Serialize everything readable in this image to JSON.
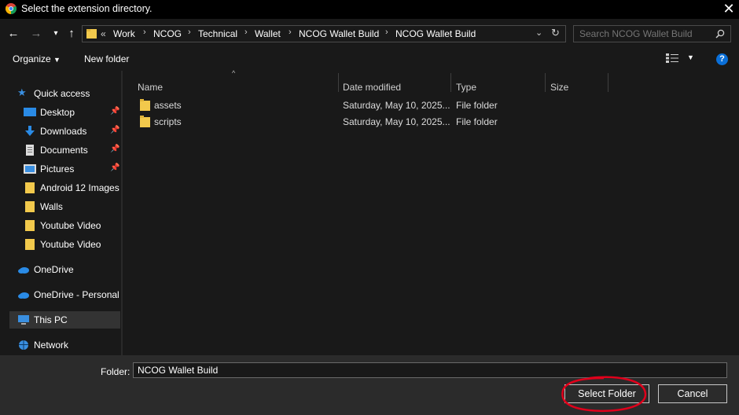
{
  "window": {
    "title": "Select the extension directory."
  },
  "address_bar": {
    "overflow": "«",
    "crumbs": [
      "Work",
      "NCOG",
      "Technical",
      "Wallet",
      "NCOG Wallet Build",
      "NCOG Wallet Build"
    ]
  },
  "search": {
    "placeholder": "Search NCOG Wallet Build"
  },
  "toolbar": {
    "organize": "Organize",
    "new_folder": "New folder"
  },
  "sidebar": {
    "items": [
      {
        "label": "Quick access",
        "icon": "star-icon"
      },
      {
        "label": "Desktop",
        "icon": "desktop-icon",
        "pinned": true
      },
      {
        "label": "Downloads",
        "icon": "download-icon",
        "pinned": true
      },
      {
        "label": "Documents",
        "icon": "document-icon",
        "pinned": true
      },
      {
        "label": "Pictures",
        "icon": "picture-icon",
        "pinned": true
      },
      {
        "label": "Android 12 Images",
        "icon": "folder-icon"
      },
      {
        "label": "Walls",
        "icon": "folder-icon"
      },
      {
        "label": "Youtube Video",
        "icon": "folder-icon"
      },
      {
        "label": "Youtube Video",
        "icon": "folder-icon"
      },
      {
        "label": "OneDrive",
        "icon": "cloud-icon"
      },
      {
        "label": "OneDrive - Personal",
        "icon": "cloud-icon"
      },
      {
        "label": "This PC",
        "icon": "computer-icon",
        "selected": true
      },
      {
        "label": "Network",
        "icon": "network-icon"
      }
    ]
  },
  "file_list": {
    "columns": [
      "Name",
      "Date modified",
      "Type",
      "Size"
    ],
    "rows": [
      {
        "name": "assets",
        "date": "Saturday, May 10, 2025...",
        "type": "File folder",
        "size": ""
      },
      {
        "name": "scripts",
        "date": "Saturday, May 10, 2025...",
        "type": "File folder",
        "size": ""
      }
    ]
  },
  "footer": {
    "folder_label": "Folder:",
    "folder_value": "NCOG Wallet Build",
    "select_button": "Select Folder",
    "cancel_button": "Cancel"
  },
  "colors": {
    "background": "#191919",
    "footer": "#2b2b2b",
    "highlight_circle": "#e0001b",
    "folder": "#f2c94c",
    "accent": "#0a84ff"
  }
}
